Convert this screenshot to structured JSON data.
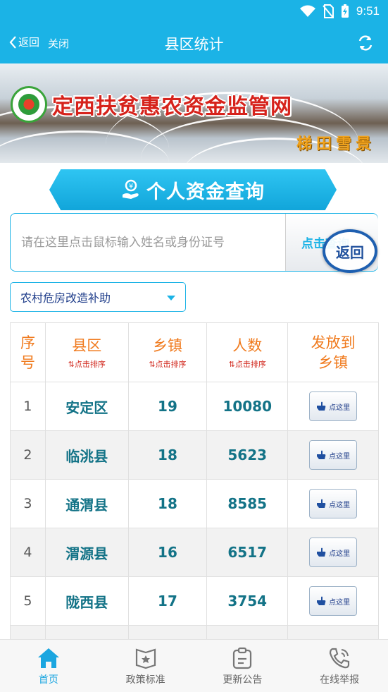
{
  "status_bar": {
    "time": "9:51"
  },
  "nav": {
    "back_label": "返回",
    "close_label": "关闭",
    "title": "县区统计"
  },
  "banner": {
    "title": "定西扶贫惠农资金监管网",
    "subtitle": "梯田雪景"
  },
  "section": {
    "title": "个人资金查询"
  },
  "search": {
    "placeholder": "请在这里点击鼠标输入姓名或身份证号",
    "button_label": "点击查询",
    "float_return_label": "返回"
  },
  "filter": {
    "selected": "农村危房改造补助"
  },
  "table": {
    "headers": {
      "idx": [
        "序",
        "号"
      ],
      "county": "县区",
      "town": "乡镇",
      "people": "人数",
      "dist": [
        "发放到",
        "乡镇"
      ],
      "sort_hint": "⇅点击排序"
    },
    "button_label": "点这里",
    "rows": [
      {
        "idx": "1",
        "county": "安定区",
        "towns": "19",
        "people": "10080"
      },
      {
        "idx": "2",
        "county": "临洮县",
        "towns": "18",
        "people": "5623"
      },
      {
        "idx": "3",
        "county": "通渭县",
        "towns": "18",
        "people": "8585"
      },
      {
        "idx": "4",
        "county": "渭源县",
        "towns": "16",
        "people": "6517"
      },
      {
        "idx": "5",
        "county": "陇西县",
        "towns": "17",
        "people": "3754"
      }
    ]
  },
  "tabs": [
    {
      "label": "首页",
      "icon": "home-icon",
      "active": true
    },
    {
      "label": "政策标准",
      "icon": "policy-book-icon",
      "active": false
    },
    {
      "label": "更新公告",
      "icon": "clipboard-icon",
      "active": false
    },
    {
      "label": "在线举报",
      "icon": "phone-icon",
      "active": false
    }
  ],
  "colors": {
    "accent": "#1bb3e6",
    "header_text": "#f07a1d",
    "data_text": "#137387",
    "banner_title": "#d6221b"
  }
}
